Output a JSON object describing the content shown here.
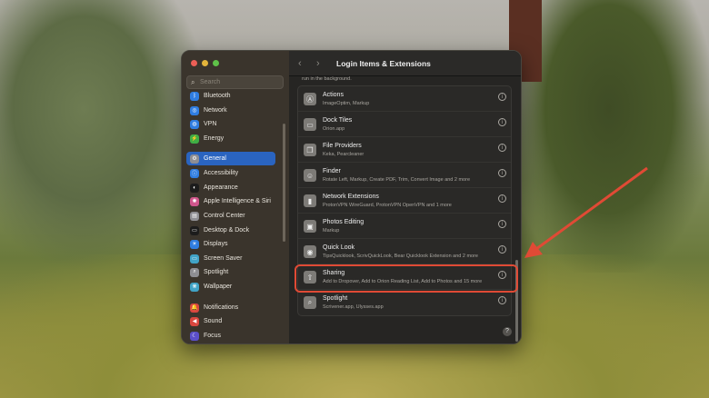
{
  "window": {
    "title": "Login Items & Extensions",
    "note": "run in the background.",
    "help": "?"
  },
  "sidebar": {
    "search_placeholder": "Search",
    "items": [
      {
        "label": "Bluetooth",
        "color": "#2f7de1",
        "glyph": "ᛒ"
      },
      {
        "label": "Network",
        "color": "#2f7de1",
        "glyph": "◎"
      },
      {
        "label": "VPN",
        "color": "#2f7de1",
        "glyph": "◍"
      },
      {
        "label": "Energy",
        "color": "#3fae45",
        "glyph": "⚡"
      },
      {
        "label": "General",
        "color": "#8e8e93",
        "glyph": "⚙"
      },
      {
        "label": "Accessibility",
        "color": "#2f7de1",
        "glyph": "ⓘ"
      },
      {
        "label": "Appearance",
        "color": "#1c1c1c",
        "glyph": "◐"
      },
      {
        "label": "Apple Intelligence & Siri",
        "color": "#d0568c",
        "glyph": "✺"
      },
      {
        "label": "Control Center",
        "color": "#8e8e93",
        "glyph": "▤"
      },
      {
        "label": "Desktop & Dock",
        "color": "#1c1c1c",
        "glyph": "▭"
      },
      {
        "label": "Displays",
        "color": "#2f7de1",
        "glyph": "☀"
      },
      {
        "label": "Screen Saver",
        "color": "#41a3c6",
        "glyph": "▭"
      },
      {
        "label": "Spotlight",
        "color": "#8e8e93",
        "glyph": "⌕"
      },
      {
        "label": "Wallpaper",
        "color": "#41a3c6",
        "glyph": "❋"
      },
      {
        "label": "Notifications",
        "color": "#d9473f",
        "glyph": "🔔"
      },
      {
        "label": "Sound",
        "color": "#d9473f",
        "glyph": "◀"
      },
      {
        "label": "Focus",
        "color": "#5b4fc9",
        "glyph": "☾"
      }
    ],
    "selected": "General"
  },
  "extensions": [
    {
      "title": "Actions",
      "subtitle": "ImageOptim, Markup",
      "glyph": "Ⓐ"
    },
    {
      "title": "Dock Tiles",
      "subtitle": "Orion.app",
      "glyph": "▭"
    },
    {
      "title": "File Providers",
      "subtitle": "Keka, Pearcleaner",
      "glyph": "❐"
    },
    {
      "title": "Finder",
      "subtitle": "Rotate Left, Markup, Create PDF, Trim, Convert Image and 2 more",
      "glyph": "☺"
    },
    {
      "title": "Network Extensions",
      "subtitle": "ProtonVPN WireGuard, ProtonVPN OpenVPN and 1 more",
      "glyph": "▮"
    },
    {
      "title": "Photos Editing",
      "subtitle": "Markup",
      "glyph": "▣"
    },
    {
      "title": "Quick Look",
      "subtitle": "TipsQuicklook, ScrivQuickLook, Bear Quicklook Extension and 2 more",
      "glyph": "◉"
    },
    {
      "title": "Sharing",
      "subtitle": "Add to Dropover, Add to Orion Reading List, Add to Photos and 15 more",
      "glyph": "⇧"
    },
    {
      "title": "Spotlight",
      "subtitle": "Scrivener.app, Ulysses.app",
      "glyph": "⌕"
    }
  ],
  "highlight_color": "#e04a35"
}
